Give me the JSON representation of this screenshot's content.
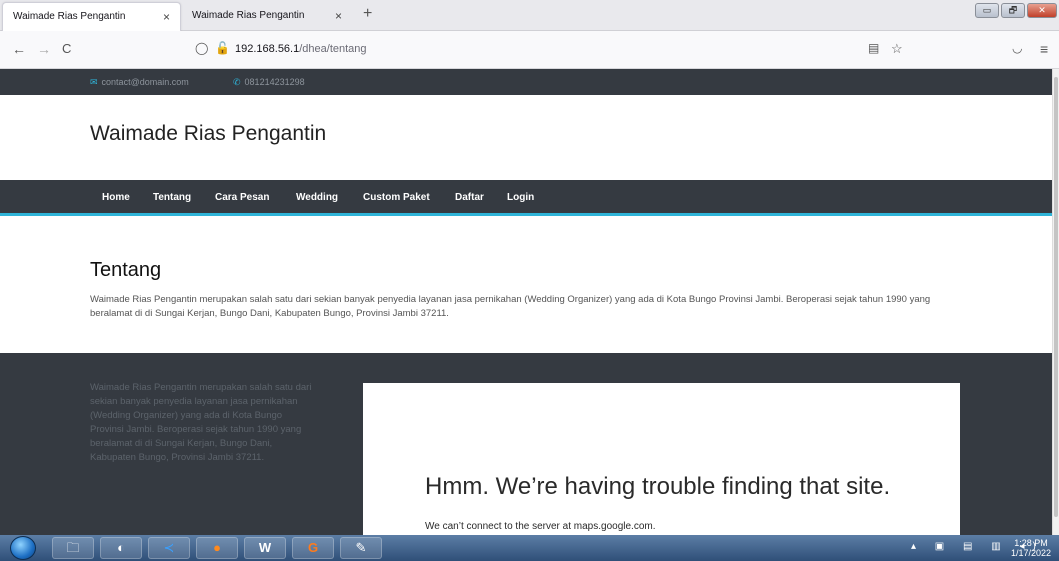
{
  "browser": {
    "tabs": [
      {
        "title": "Waimade Rias Pengantin",
        "active": true
      },
      {
        "title": "Waimade Rias Pengantin",
        "active": false
      }
    ],
    "new_tab_glyph": "+",
    "close_glyph": "×",
    "url": {
      "host": "192.168.56.1",
      "path": "/dhea/tentang"
    },
    "icons": {
      "back": "←",
      "forward": "→",
      "reload": "C",
      "shield": "◯",
      "lock_warning": "🔓",
      "reader": "▤",
      "bookmark": "☆",
      "pocket": "◡",
      "menu": "≡"
    },
    "window_controls": {
      "minimize": "▭",
      "maximize": "🗗",
      "close": "✕"
    }
  },
  "site": {
    "topbar": {
      "email": "contact@domain.com",
      "phone": "081214231298"
    },
    "brand": "Waimade Rias Pengantin",
    "menu": [
      "Home",
      "Tentang",
      "Cara Pesan",
      "Wedding",
      "Custom Paket",
      "Daftar",
      "Login"
    ],
    "about": {
      "title": "Tentang",
      "text": "Waimade Rias Pengantin merupakan salah satu dari sekian banyak penyedia layanan jasa pernikahan (Wedding Organizer) yang ada di Kota Bungo Provinsi Jambi. Beroperasi sejak tahun 1990 yang beralamat di di Sungai Kerjan, Bungo Dani, Kabupaten Bungo, Provinsi Jambi 37211."
    },
    "footer": {
      "text": "Waimade Rias Pengantin merupakan salah satu dari sekian banyak penyedia layanan jasa pernikahan (Wedding Organizer) yang ada di Kota Bungo Provinsi Jambi. Beroperasi sejak tahun 1990 yang beralamat di di Sungai Kerjan, Bungo Dani, Kabupaten Bungo, Provinsi Jambi 37211.",
      "map_error": {
        "title": "Hmm. We’re having trouble finding that site.",
        "desc": "We can’t connect to the server at maps.google.com."
      }
    }
  },
  "taskbar": {
    "apps": [
      "ie-icon",
      "folder-icon",
      "media-icon",
      "vscode-icon",
      "firefox-icon",
      "word-icon",
      "app-icon",
      "paint-icon"
    ],
    "clock": {
      "time": "1:28 PM",
      "date": "1/17/2022"
    }
  },
  "colors": {
    "dark": "#353a41",
    "accent": "#2fb4d8"
  }
}
